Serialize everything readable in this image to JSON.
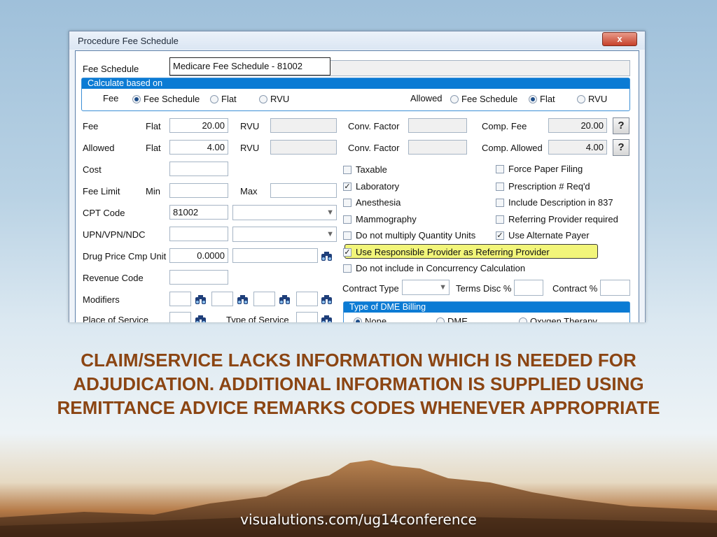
{
  "window": {
    "title": "Procedure Fee Schedule",
    "close_label": "x"
  },
  "fee_schedule": {
    "label": "Fee Schedule",
    "value": "Medicare Fee Schedule - 81002"
  },
  "calculate": {
    "header": "Calculate based on",
    "fee_label": "Fee",
    "fee_options": [
      "Fee Schedule",
      "Flat",
      "RVU"
    ],
    "fee_selected": "Fee Schedule",
    "allowed_label": "Allowed",
    "allowed_options": [
      "Fee Schedule",
      "Flat",
      "RVU"
    ],
    "allowed_selected": "Flat"
  },
  "fee_row": {
    "label": "Fee",
    "mode": "Flat",
    "value": "20.00",
    "rvu_label": "RVU",
    "conv_label": "Conv. Factor",
    "comp_label": "Comp. Fee",
    "comp_value": "20.00",
    "help": "?"
  },
  "allowed_row": {
    "label": "Allowed",
    "mode": "Flat",
    "value": "4.00",
    "rvu_label": "RVU",
    "conv_label": "Conv. Factor",
    "comp_label": "Comp. Allowed",
    "comp_value": "4.00",
    "help": "?"
  },
  "cost": {
    "label": "Cost"
  },
  "fee_limit": {
    "label": "Fee Limit",
    "min_label": "Min",
    "max_label": "Max"
  },
  "cpt": {
    "label": "CPT Code",
    "value": "81002"
  },
  "upn": {
    "label": "UPN/VPN/NDC"
  },
  "drug": {
    "label": "Drug Price Cmp Unit",
    "value": "0.0000"
  },
  "revenue": {
    "label": "Revenue Code"
  },
  "modifiers": {
    "label": "Modifiers"
  },
  "pos": {
    "label": "Place of Service",
    "tos_label": "Type of Service"
  },
  "checkboxes_left": [
    {
      "label": "Taxable",
      "checked": false
    },
    {
      "label": "Laboratory",
      "checked": true
    },
    {
      "label": "Anesthesia",
      "checked": false
    },
    {
      "label": "Mammography",
      "checked": false
    },
    {
      "label": "Do not multiply Quantity Units",
      "checked": false
    }
  ],
  "checkboxes_right": [
    {
      "label": "Force Paper Filing",
      "checked": false
    },
    {
      "label": "Prescription # Req'd",
      "checked": false
    },
    {
      "label": "Include Description in 837",
      "checked": false
    },
    {
      "label": "Referring Provider required",
      "checked": false
    },
    {
      "label": "Use Alternate Payer",
      "checked": true
    }
  ],
  "highlighted_checkbox": {
    "label": "Use Responsible Provider as Referring Provider",
    "checked": true
  },
  "concurrency": {
    "label": "Do not include in Concurrency Calculation",
    "checked": false
  },
  "contract": {
    "type_label": "Contract Type",
    "terms_label": "Terms Disc %",
    "contract_label": "Contract %"
  },
  "dme": {
    "header": "Type of DME Billing",
    "options": [
      "None",
      "DME",
      "Oxygen Therapy"
    ],
    "selected": "None"
  },
  "caption": "CLAIM/SERVICE LACKS INFORMATION WHICH IS NEEDED FOR ADJUDICATION. ADDITIONAL INFORMATION IS SUPPLIED USING REMITTANCE ADVICE REMARKS CODES WHENEVER APPROPRIATE",
  "footer_url": "visualutions.com/ug14conference",
  "colors": {
    "caption": "#8b4513",
    "group_header": "#0b7bd4",
    "highlight": "#f2f57a"
  }
}
